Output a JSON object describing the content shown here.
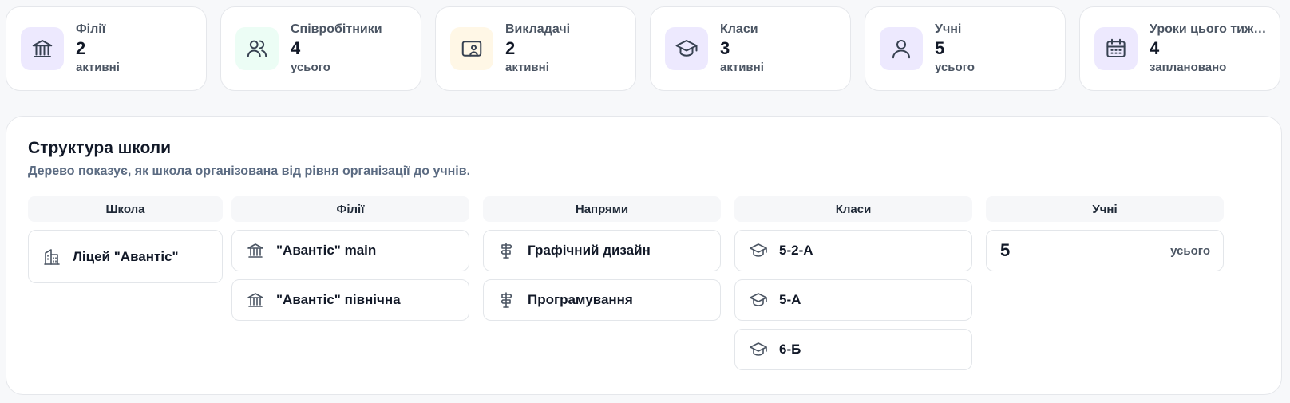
{
  "stats": [
    {
      "label": "Філії",
      "value": "2",
      "sub": "активні",
      "icon": "bank-icon",
      "color": "#ede9fe"
    },
    {
      "label": "Співробітники",
      "value": "4",
      "sub": "усього",
      "icon": "users-icon",
      "color": "#ecfdf5"
    },
    {
      "label": "Викладачі",
      "value": "2",
      "sub": "активні",
      "icon": "teacher-board-icon",
      "color": "#fff7e6"
    },
    {
      "label": "Класи",
      "value": "3",
      "sub": "активні",
      "icon": "graduation-cap-icon",
      "color": "#ede9fe"
    },
    {
      "label": "Учні",
      "value": "5",
      "sub": "усього",
      "icon": "user-icon",
      "color": "#ede9fe"
    },
    {
      "label": "Уроки цього тиж…",
      "value": "4",
      "sub": "заплановано",
      "icon": "calendar-icon",
      "color": "#ede9fe"
    }
  ],
  "structure": {
    "title": "Структура школи",
    "subtitle": "Дерево показує, як школа організована від рівня організації до учнів.",
    "columns": {
      "school": {
        "header": "Школа",
        "items": [
          "Ліцей \"Авантіс\""
        ]
      },
      "branches": {
        "header": "Філії",
        "items": [
          "\"Авантіс\" main",
          "\"Авантіс\" північна"
        ]
      },
      "directions": {
        "header": "Напрями",
        "items": [
          "Графічний дизайн",
          "Програмування"
        ]
      },
      "classes": {
        "header": "Класи",
        "items": [
          "5-2-А",
          "5-А",
          "6-Б"
        ]
      },
      "students": {
        "header": "Учні",
        "count": "5",
        "count_label": "усього"
      }
    }
  }
}
